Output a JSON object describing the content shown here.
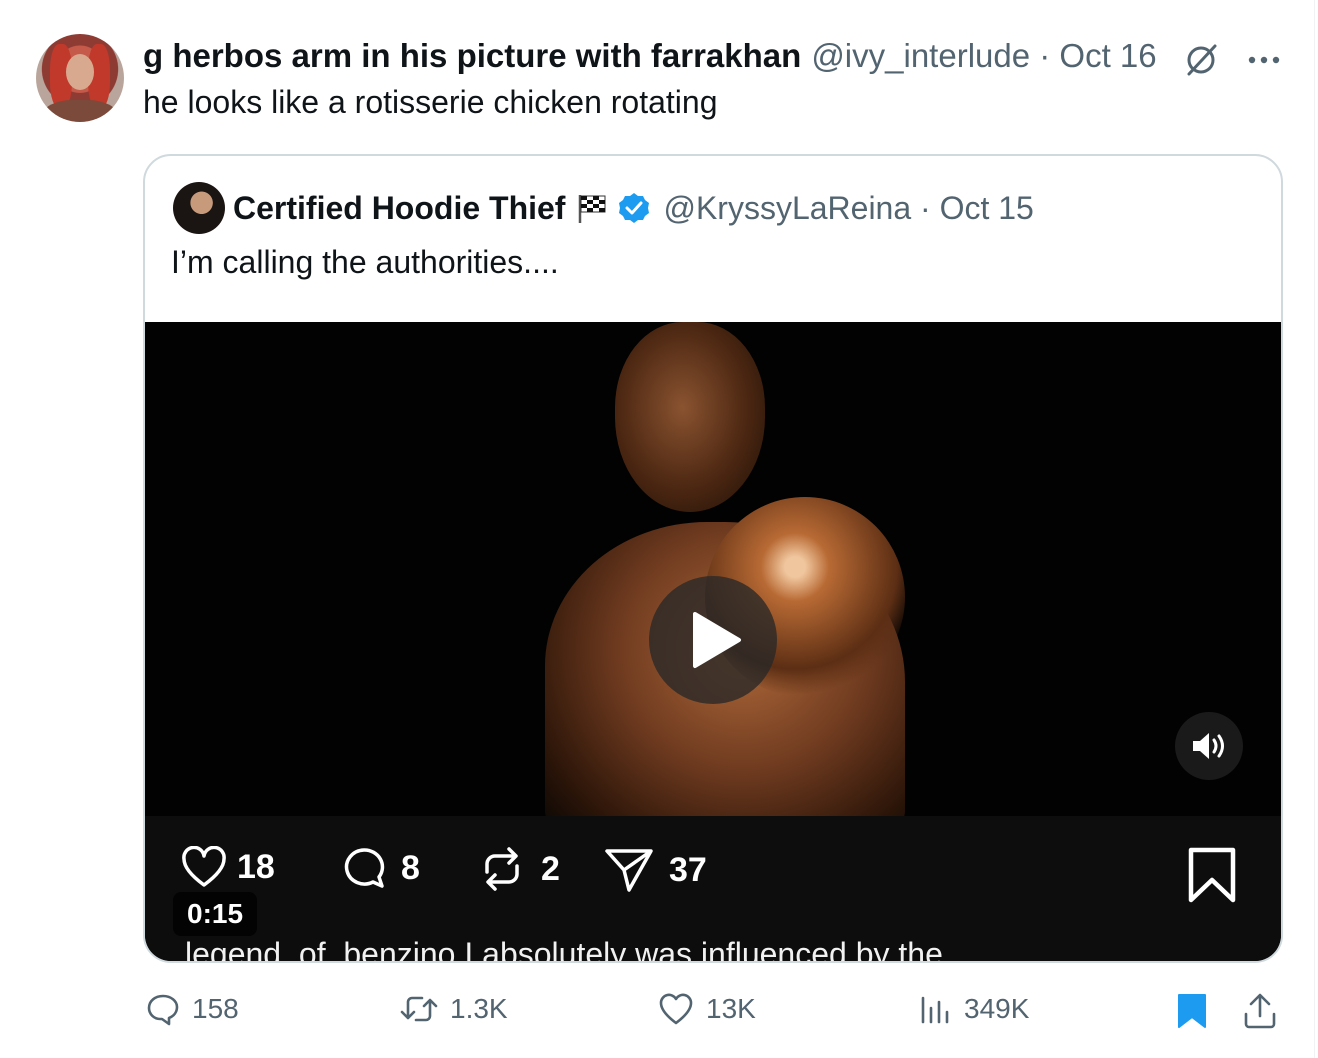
{
  "tweet": {
    "author_name": "g herbos arm in his picture with farrakhan",
    "handle_date": "@ivy_interlude · Oct 16",
    "text": "he looks like a rotisserie chicken rotating"
  },
  "quoted": {
    "author_name": "Certified Hoodie Thief",
    "handle_date": "@KryssyLaReina · Oct 15",
    "text": "I’m calling the authorities....",
    "video": {
      "duration": "0:15",
      "overlay": {
        "likes": "18",
        "comments": "8",
        "reposts": "2",
        "shares": "37",
        "caption": "legend_of_benzino I absolutely was influenced by the"
      }
    }
  },
  "actions": {
    "replies": "158",
    "reposts": "1.3K",
    "likes": "13K",
    "views": "349K"
  },
  "colors": {
    "verified": "#1d9bf0",
    "bookmark_active": "#1d9bf0",
    "muted_text": "#536471",
    "border": "#cfd9de"
  },
  "icons": [
    "no-entry-icon",
    "more-icon",
    "checkered-flag-icon",
    "verified-badge-icon",
    "play-icon",
    "volume-icon",
    "heart-icon",
    "comment-icon",
    "repost-icon",
    "send-icon",
    "bookmark-icon",
    "reply-icon",
    "views-icon",
    "share-icon"
  ]
}
